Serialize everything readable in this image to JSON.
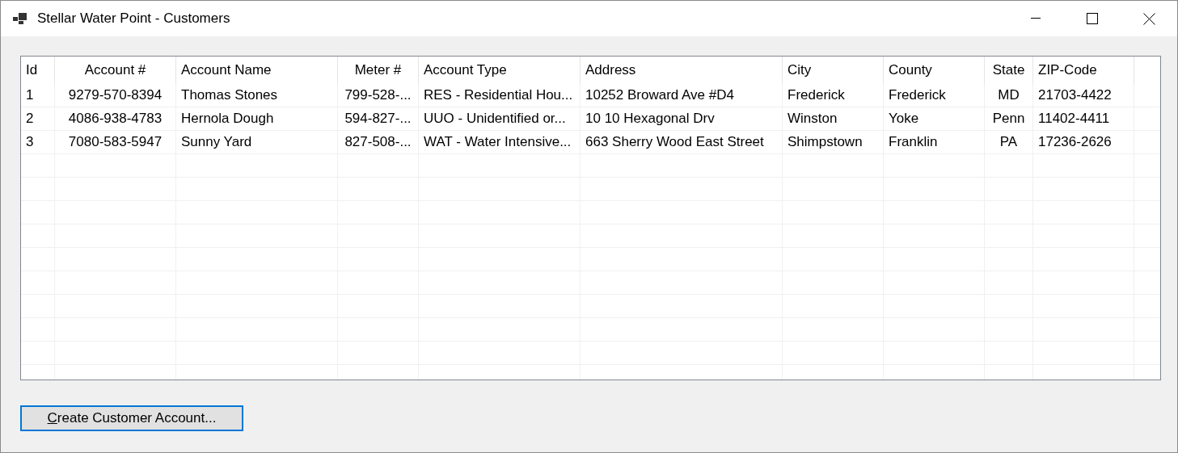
{
  "window": {
    "title": "Stellar Water Point - Customers"
  },
  "table": {
    "columns": [
      {
        "label": "Id"
      },
      {
        "label": "Account #"
      },
      {
        "label": "Account Name"
      },
      {
        "label": "Meter #"
      },
      {
        "label": "Account Type"
      },
      {
        "label": "Address"
      },
      {
        "label": "City"
      },
      {
        "label": "County"
      },
      {
        "label": "State"
      },
      {
        "label": "ZIP-Code"
      }
    ],
    "rows": [
      [
        "1",
        "9279-570-8394",
        "Thomas Stones",
        "799-528-...",
        "RES - Residential Hou...",
        "10252 Broward Ave #D4",
        "Frederick",
        "Frederick",
        "MD",
        "21703-4422"
      ],
      [
        "2",
        "4086-938-4783",
        "Hernola Dough",
        "594-827-...",
        "UUO - Unidentified or...",
        "10 10 Hexagonal Drv",
        "Winston",
        "Yoke",
        "Penn",
        "11402-4411"
      ],
      [
        "3",
        "7080-583-5947",
        "Sunny Yard",
        "827-508-...",
        "WAT - Water Intensive...",
        "663 Sherry Wood East Street",
        "Shimpstown",
        "Franklin",
        "PA",
        "17236-2626"
      ]
    ]
  },
  "button": {
    "label": "Create Customer Account...",
    "mnemonic": true
  }
}
